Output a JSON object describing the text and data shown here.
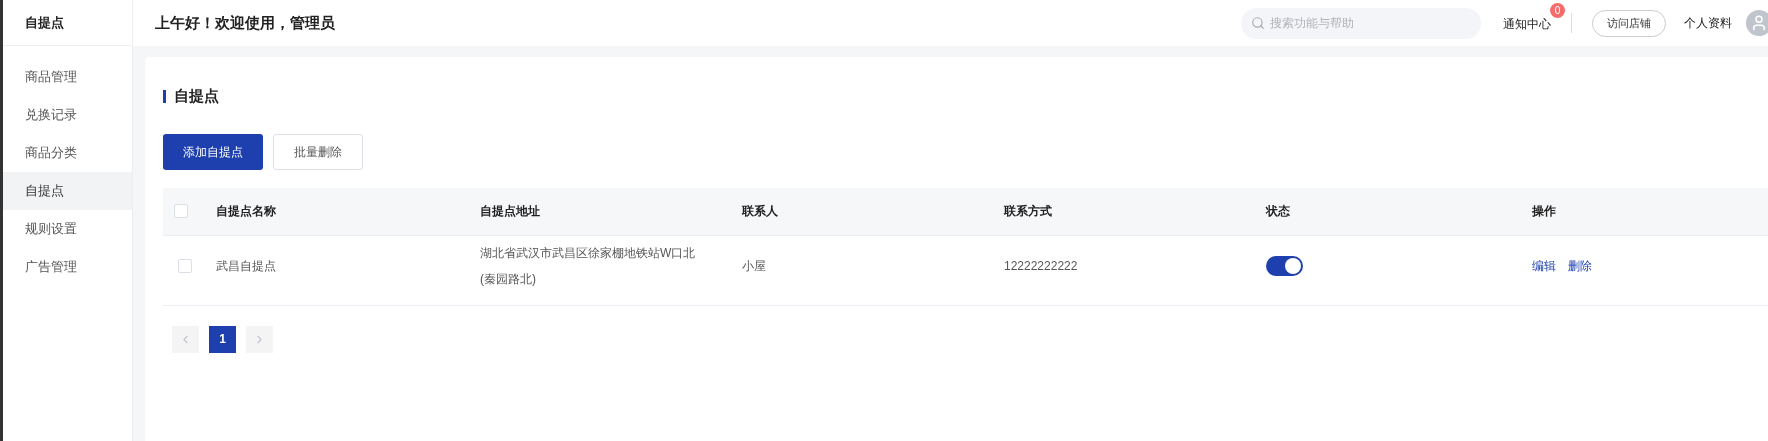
{
  "sidebar": {
    "title": "自提点",
    "items": [
      {
        "label": "商品管理",
        "selected": false
      },
      {
        "label": "兑换记录",
        "selected": false
      },
      {
        "label": "商品分类",
        "selected": false
      },
      {
        "label": "自提点",
        "selected": true
      },
      {
        "label": "规则设置",
        "selected": false
      },
      {
        "label": "广告管理",
        "selected": false
      }
    ]
  },
  "header": {
    "greeting": "上午好！欢迎使用，管理员",
    "search": {
      "placeholder": "搜索功能与帮助"
    },
    "notifications": {
      "label": "通知中心",
      "count": "0"
    },
    "visit_store": "访问店铺",
    "profile": "个人资料"
  },
  "page": {
    "title": "自提点",
    "buttons": [
      {
        "label": "添加自提点",
        "kind": "primary"
      },
      {
        "label": "批量删除",
        "kind": "default"
      }
    ]
  },
  "table": {
    "columns": [
      "自提点名称",
      "自提点地址",
      "联系人",
      "联系方式",
      "状态",
      "操作"
    ],
    "header_checked": false,
    "rows": [
      {
        "checked": false,
        "name": "武昌自提点",
        "address": "湖北省武汉市武昌区徐家棚地铁站W口北(秦园路北)",
        "contact": "小屋",
        "phone": "12222222222",
        "status_on": true,
        "actions": [
          "编辑",
          "删除"
        ]
      }
    ]
  },
  "pagination": {
    "pages": [
      {
        "label": "1",
        "selected": true
      }
    ]
  }
}
